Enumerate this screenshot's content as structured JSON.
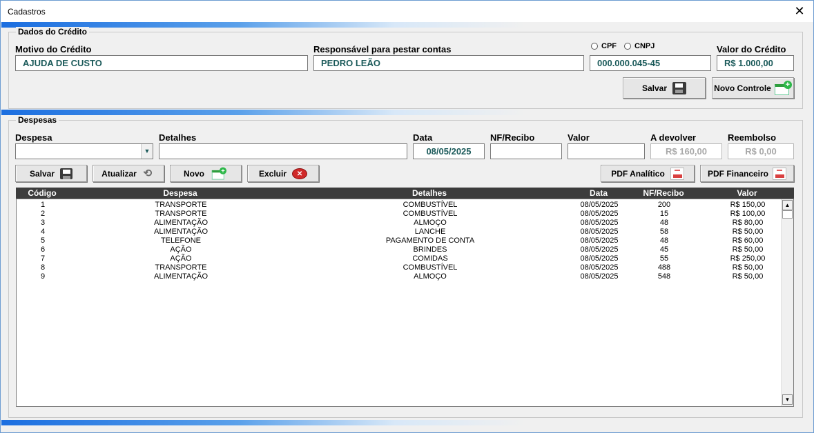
{
  "window": {
    "title": "Cadastros",
    "close_symbol": "✕"
  },
  "credit": {
    "frame_title": "Dados do Crédito",
    "motivo_label": "Motivo do Crédito",
    "motivo_value": "AJUDA DE CUSTO",
    "responsavel_label": "Responsável para pestar contas",
    "responsavel_value": "PEDRO LEÃO",
    "cpf_label": "CPF",
    "cnpj_label": "CNPJ",
    "documento_value": "000.000.045-45",
    "valor_label": "Valor do Crédito",
    "valor_value": "R$ 1.000,00",
    "save_label": "Salvar",
    "new_control_label": "Novo Controle"
  },
  "expenses": {
    "frame_title": "Despesas",
    "despesa_label": "Despesa",
    "despesa_value": "",
    "detalhes_label": "Detalhes",
    "detalhes_value": "",
    "data_label": "Data",
    "data_value": "08/05/2025",
    "nf_label": "NF/Recibo",
    "nf_value": "",
    "valor_label": "Valor",
    "valor_value": "",
    "devolver_label": "A devolver",
    "devolver_value": "R$ 160,00",
    "reembolso_label": "Reembolso",
    "reembolso_value": "R$ 0,00",
    "buttons": {
      "save": "Salvar",
      "update": "Atualizar",
      "new": "Novo",
      "delete": "Excluir",
      "pdf_analytic": "PDF Analítico",
      "pdf_financial": "PDF Financeiro"
    },
    "columns": [
      "Código",
      "Despesa",
      "Detalhes",
      "Data",
      "NF/Recibo",
      "Valor"
    ],
    "rows": [
      [
        "1",
        "TRANSPORTE",
        "COMBUSTÍVEL",
        "08/05/2025",
        "200",
        "R$ 150,00"
      ],
      [
        "2",
        "TRANSPORTE",
        "COMBUSTÍVEL",
        "08/05/2025",
        "15",
        "R$ 100,00"
      ],
      [
        "3",
        "ALIMENTAÇÃO",
        "ALMOÇO",
        "08/05/2025",
        "48",
        "R$ 80,00"
      ],
      [
        "4",
        "ALIMENTAÇÃO",
        "LANCHE",
        "08/05/2025",
        "58",
        "R$ 50,00"
      ],
      [
        "5",
        "TELEFONE",
        "PAGAMENTO DE CONTA",
        "08/05/2025",
        "48",
        "R$ 60,00"
      ],
      [
        "6",
        "AÇÃO",
        "BRINDES",
        "08/05/2025",
        "45",
        "R$ 50,00"
      ],
      [
        "7",
        "AÇÃO",
        "COMIDAS",
        "08/05/2025",
        "55",
        "R$ 250,00"
      ],
      [
        "8",
        "TRANSPORTE",
        "COMBUSTÍVEL",
        "08/05/2025",
        "488",
        "R$ 50,00"
      ],
      [
        "9",
        "ALIMENTAÇÃO",
        "ALMOÇO",
        "08/05/2025",
        "548",
        "R$ 50,00"
      ]
    ]
  },
  "icons": {
    "save": "floppy-disk-icon",
    "new": "new-sheet-plus-icon",
    "refresh": "refresh-icon",
    "delete": "red-x-circle-icon",
    "pdf": "pdf-file-icon",
    "dropdown": "chevron-down-icon"
  }
}
